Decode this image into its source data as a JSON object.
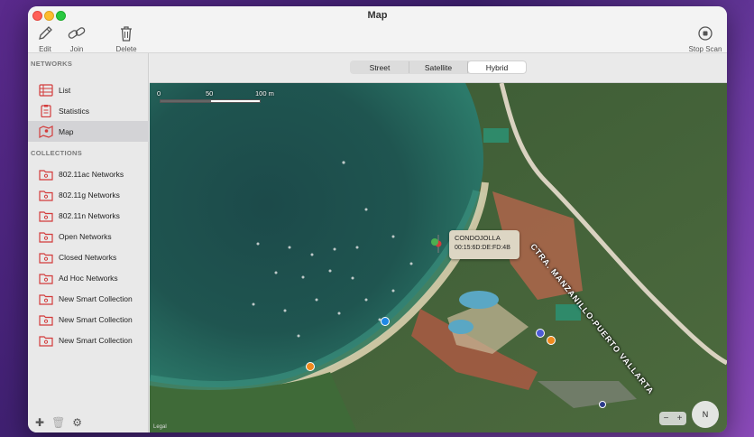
{
  "window": {
    "title": "Map"
  },
  "toolbar": {
    "edit": "Edit",
    "join": "Join",
    "delete": "Delete",
    "stop_scan": "Stop Scan"
  },
  "sidebar": {
    "networks_title": "NETWORKS",
    "networks": [
      {
        "label": "List",
        "icon": "list-icon"
      },
      {
        "label": "Statistics",
        "icon": "clipboard-icon"
      },
      {
        "label": "Map",
        "icon": "map-icon",
        "selected": true
      }
    ],
    "collections_title": "COLLECTIONS",
    "collections": [
      {
        "label": "802.11ac Networks"
      },
      {
        "label": "802.11g Networks"
      },
      {
        "label": "802.11n Networks"
      },
      {
        "label": "Open Networks"
      },
      {
        "label": "Closed Networks"
      },
      {
        "label": "Ad Hoc Networks"
      },
      {
        "label": "New Smart Collection"
      },
      {
        "label": "New Smart Collection"
      },
      {
        "label": "New Smart Collection"
      }
    ]
  },
  "map_type": {
    "options": [
      "Street",
      "Satellite",
      "Hybrid"
    ],
    "selected": "Hybrid"
  },
  "map": {
    "scale_labels": [
      "0",
      "50",
      "100 m"
    ],
    "road_label": "CTRA. MANZANILLO-PUERTO VALLARTA",
    "pin": {
      "name": "CONDOJOLLA",
      "mac": "00:15:6D:DE:FD:4B"
    },
    "legal": "Legal",
    "zoom_out": "−",
    "zoom_in": "+",
    "compass": "N"
  },
  "colors": {
    "accent": "#d33b3b",
    "selected_row": "#d3d3d6"
  }
}
